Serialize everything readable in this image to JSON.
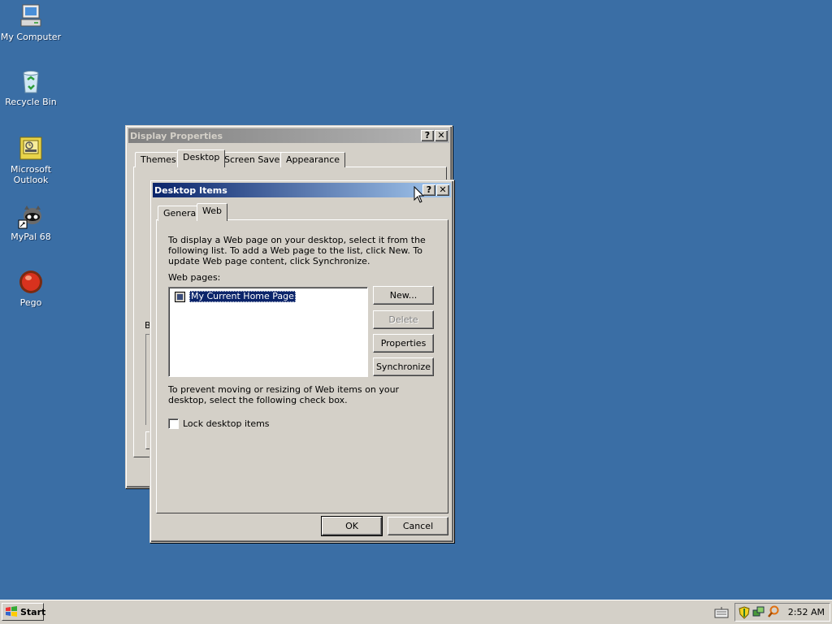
{
  "desktop": {
    "icons": [
      {
        "label": "My Computer",
        "icon": "computer-icon"
      },
      {
        "label": "Recycle Bin",
        "icon": "recycle-bin-icon"
      },
      {
        "label": "Microsoft Outlook",
        "icon": "outlook-icon"
      },
      {
        "label": "MyPal 68",
        "icon": "mypal-icon"
      },
      {
        "label": "Pego",
        "icon": "pego-icon"
      }
    ],
    "background_color": "#3a6ea5"
  },
  "display_properties": {
    "title": "Display Properties",
    "tabs": [
      "Themes",
      "Desktop",
      "Screen Saver",
      "Appearance"
    ],
    "selected_tab": "Desktop",
    "partial_label": "B"
  },
  "desktop_items": {
    "title": "Desktop Items",
    "help_glyph": "?",
    "close_glyph": "✕",
    "tabs": [
      "General",
      "Web"
    ],
    "selected_tab": "Web",
    "intro_text": "To display a Web page on your desktop, select it from the following list. To add a Web page to the list, click New.  To update Web page content, click Synchronize.",
    "web_pages_label": "Web pages:",
    "web_pages": [
      {
        "label": "My Current Home Page",
        "checked": false,
        "selected": true
      }
    ],
    "buttons": {
      "new": "New...",
      "delete": "Delete",
      "properties": "Properties",
      "synchronize": "Synchronize"
    },
    "lock_text": "To prevent moving or resizing of Web items on your desktop, select the following check box.",
    "lock_checkbox_label": "Lock desktop items",
    "ok": "OK",
    "cancel": "Cancel"
  },
  "taskbar": {
    "start_label": "Start",
    "clock": "2:52 AM",
    "tray_icons": [
      "keyboard-icon",
      "shield-icon",
      "network-icon",
      "search-icon"
    ]
  },
  "colors": {
    "titlebar_active_start": "#0a246a",
    "titlebar_active_end": "#a6caf0",
    "face": "#d4d0c8"
  }
}
